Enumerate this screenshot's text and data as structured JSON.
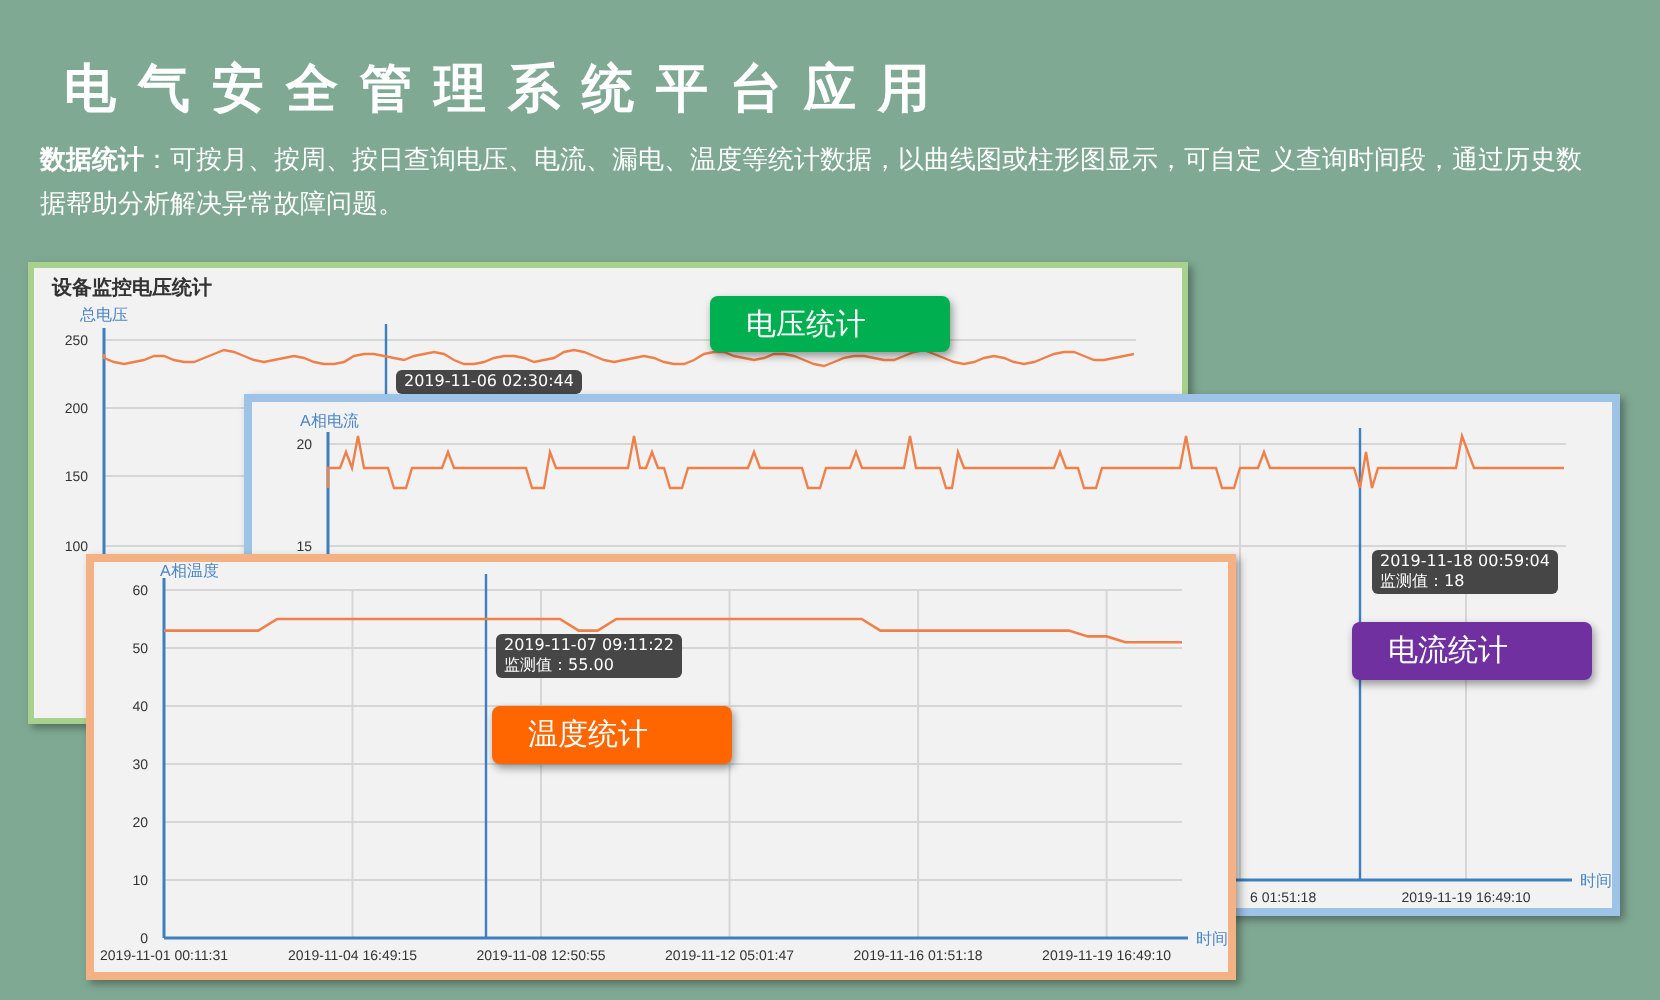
{
  "title": "电气安全管理系统平台应用",
  "description": "**数据统计**：可按月、按周、按日查询电压、电流、漏电、温度等统计数据，以曲线图或柱形图显示，可自定 义查询时间段，通过历史数据帮助分析解决异常故障问题。",
  "panels": [
    {
      "kind": "picture",
      "title": "设备监控电压统计",
      "color": "#a9d18e",
      "badge": {
        "text": "电压统计",
        "color": "#00b050"
      },
      "tooltip": {
        "time": "2019-11-06 02:30:44"
      },
      "axis": {
        "y_title": "总电压",
        "y_labels": [
          "250",
          "200",
          "150",
          "100"
        ]
      }
    },
    {
      "kind": "picture",
      "color": "#9dc3e6",
      "badge": {
        "text": "电流统计",
        "color": "#7030a0"
      },
      "tooltip": {
        "time": "2019-11-18 00:59:04",
        "value": "监测值：18"
      },
      "axis": {
        "y_title": "A相电流",
        "y_labels": [
          "20",
          "15"
        ],
        "x_title": "时间",
        "x_labels": [
          "6 01:51:18",
          "2019-11-19 16:49:10"
        ]
      }
    },
    {
      "kind": "chart",
      "color": "#f4b183",
      "badge": {
        "text": "温度统计",
        "color": "#ff6600"
      },
      "tooltip": {
        "time": "2019-11-07 09:11:22",
        "value": "监测值：55.00"
      },
      "chart_data": {
        "type": "line",
        "ylabel": "A相温度",
        "xlabel": "时间",
        "grid": true,
        "ylim": [
          0,
          60
        ],
        "yticks": [
          0,
          10,
          20,
          30,
          40,
          50,
          60
        ],
        "categories": [
          "2019-11-01 00:11:31",
          null,
          null,
          null,
          null,
          null,
          null,
          null,
          null,
          null,
          "2019-11-04 16:49:15",
          null,
          null,
          null,
          null,
          null,
          null,
          null,
          null,
          null,
          "2019-11-08 12:50:55",
          null,
          null,
          null,
          null,
          null,
          null,
          null,
          null,
          null,
          "2019-11-12 05:01:47",
          null,
          null,
          null,
          null,
          null,
          null,
          null,
          null,
          null,
          "2019-11-16 01:51:18",
          null,
          null,
          null,
          null,
          null,
          null,
          null,
          null,
          null,
          "2019-11-19 16:49:10",
          null,
          null,
          null,
          null
        ],
        "series": [
          {
            "color": "#f0804a",
            "values": [
              53,
              53,
              53,
              53,
              53,
              53,
              55,
              55,
              55,
              55,
              55,
              55,
              55,
              55,
              55,
              55,
              55,
              55,
              55,
              55,
              55,
              55,
              53,
              53,
              55,
              55,
              55,
              55,
              55,
              55,
              55,
              55,
              55,
              55,
              55,
              55,
              55,
              55,
              53,
              53,
              53,
              53,
              53,
              53,
              53,
              53,
              53,
              53,
              53,
              52,
              52,
              51,
              51,
              51,
              51
            ]
          }
        ]
      }
    }
  ]
}
